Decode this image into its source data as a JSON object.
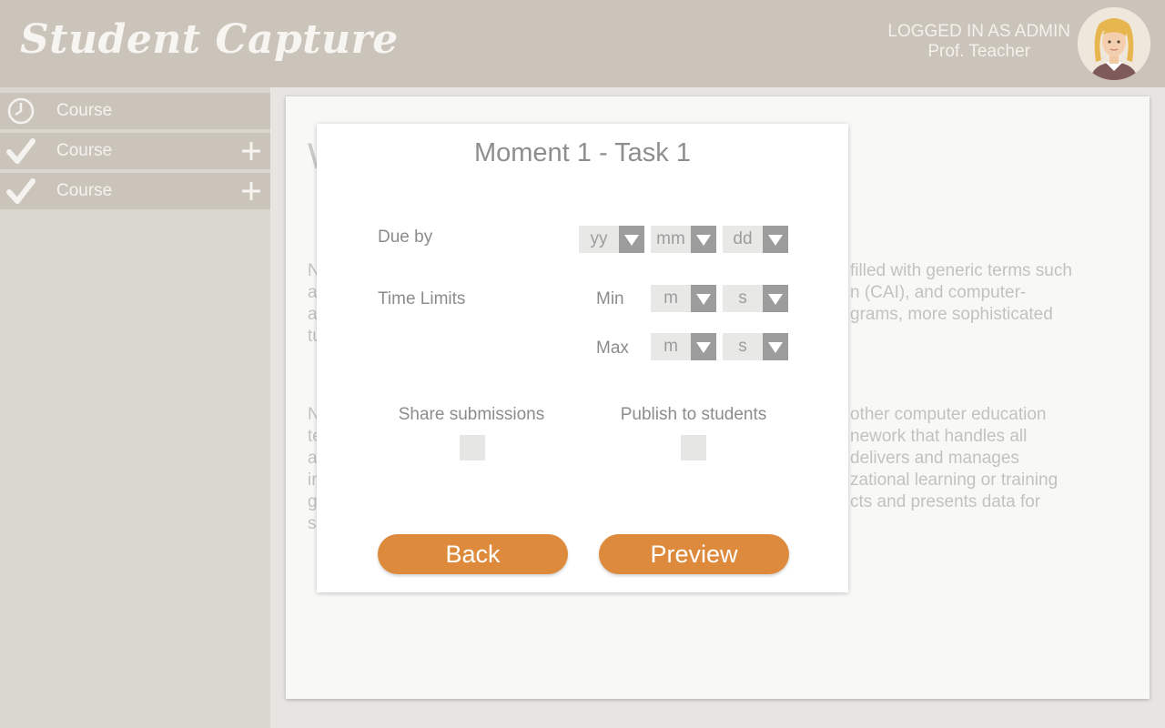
{
  "app": {
    "logo_text": "Student Capture"
  },
  "user": {
    "status": "LOGGED IN AS ADMIN",
    "name": "Prof. Teacher",
    "avatar_icon": "user-avatar"
  },
  "sidebar": {
    "items": [
      {
        "label": "Course",
        "icon": "clock-icon",
        "has_add": false
      },
      {
        "label": "Course",
        "icon": "checkmark-icon",
        "has_add": true
      },
      {
        "label": "Course",
        "icon": "checkmark-icon",
        "has_add": true
      }
    ]
  },
  "background": {
    "title_fragment": "W",
    "para1": [
      {
        "left": "N",
        "right": "filled with generic terms such"
      },
      {
        "left": "a",
        "right": "n (CAI), and computer-"
      },
      {
        "left": "a",
        "right": "grams, more sophisticated"
      },
      {
        "left": "tu",
        "right": ""
      }
    ],
    "para2": [
      {
        "left": "N",
        "right": "other computer education"
      },
      {
        "left": "te",
        "right": "nework that handles all"
      },
      {
        "left": "a",
        "right": "delivers and manages"
      },
      {
        "left": "in",
        "right": "zational learning or training"
      },
      {
        "left": "g",
        "right": "cts and presents data for"
      },
      {
        "left": "s",
        "right": ""
      }
    ]
  },
  "modal": {
    "title": "Moment 1 - Task 1",
    "due_by": {
      "label": "Due by",
      "year": "yy",
      "month": "mm",
      "day": "dd"
    },
    "time_limits": {
      "label": "Time Limits",
      "min_label": "Min",
      "min_minutes": "m",
      "min_seconds": "s",
      "max_label": "Max",
      "max_minutes": "m",
      "max_seconds": "s"
    },
    "share_submissions": {
      "label": "Share submissions",
      "checked": false
    },
    "publish_to_students": {
      "label": "Publish to students",
      "checked": false
    },
    "back_label": "Back",
    "preview_label": "Preview"
  },
  "colors": {
    "header_bg": "#cbc4ba",
    "sidebar_bg": "#d9d7d0",
    "accent_orange": "#dd8a3c",
    "dropdown_arrow": "#9c9c9c"
  }
}
